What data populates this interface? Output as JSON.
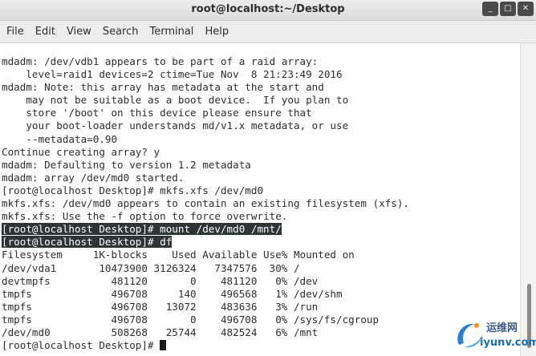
{
  "window": {
    "title": "root@localhost:~/Desktop",
    "buttons": [
      "_",
      "□",
      "✕"
    ]
  },
  "menu": [
    "File",
    "Edit",
    "View",
    "Search",
    "Terminal",
    "Help"
  ],
  "terminal": {
    "lines": [
      "mdadm: /dev/vdb1 appears to be part of a raid array:",
      "    level=raid1 devices=2 ctime=Tue Nov  8 21:23:49 2016",
      "mdadm: Note: this array has metadata at the start and",
      "    may not be suitable as a boot device.  If you plan to",
      "    store '/boot' on this device please ensure that",
      "    your boot-loader understands md/v1.x metadata, or use",
      "    --metadata=0.90",
      "Continue creating array? y",
      "mdadm: Defaulting to version 1.2 metadata",
      "mdadm: array /dev/md0 started.",
      "[root@localhost Desktop]# mkfs.xfs /dev/md0",
      "mkfs.xfs: /dev/md0 appears to contain an existing filesystem (xfs).",
      "mkfs.xfs: Use the -f option to force overwrite.",
      "[root@localhost Desktop]# mount /dev/md0 /mnt/",
      "[root@localhost Desktop]# df",
      "Filesystem     1K-blocks    Used Available Use% Mounted on",
      "/dev/vda1       10473900 3126324   7347576  30% /",
      "devtmpfs          481120       0    481120   0% /dev",
      "tmpfs             496708     140    496568   1% /dev/shm",
      "tmpfs             496708   13072    483636   3% /run",
      "tmpfs             496708       0    496708   0% /sys/fs/cgroup",
      "/dev/md0          508268   25744    482524   6% /mnt",
      "[root@localhost Desktop]# "
    ]
  },
  "watermark": {
    "line1": "运维网",
    "line2": "iyunv.com"
  },
  "colors": {
    "selection": "#2f3436",
    "text": "#2e2e2e"
  }
}
